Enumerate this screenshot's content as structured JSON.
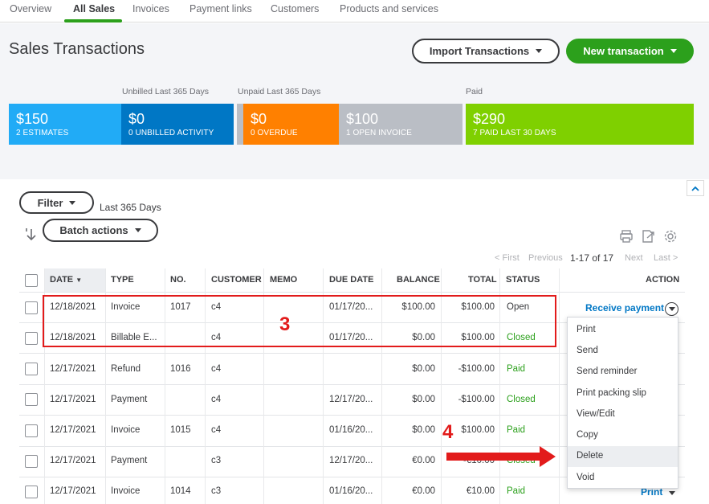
{
  "tabs": [
    {
      "label": "Overview"
    },
    {
      "label": "All Sales",
      "active": true
    },
    {
      "label": "Invoices"
    },
    {
      "label": "Payment links"
    },
    {
      "label": "Customers"
    },
    {
      "label": "Products and services"
    }
  ],
  "header": {
    "title": "Sales Transactions",
    "import_label": "Import Transactions",
    "new_label": "New transaction"
  },
  "money_bar": {
    "unbilled_label": "Unbilled Last 365 Days",
    "unpaid_label": "Unpaid Last 365 Days",
    "paid_label": "Paid",
    "tiles": [
      {
        "amount": "$150",
        "sub": "2 ESTIMATES",
        "color": "#21abf6"
      },
      {
        "amount": "$0",
        "sub": "0 UNBILLED ACTIVITY",
        "color": "#0077c5"
      },
      {
        "amount": "$0",
        "sub": "0 OVERDUE",
        "color": "#ff8000"
      },
      {
        "amount": "$100",
        "sub": "1 OPEN INVOICE",
        "color": "#babec5"
      },
      {
        "amount": "$290",
        "sub": "7 PAID LAST 30 DAYS",
        "color": "#7fd000"
      }
    ]
  },
  "filter": {
    "filter_label": "Filter",
    "range_note": "Last 365 Days",
    "batch_label": "Batch actions"
  },
  "pager": {
    "first": "< First",
    "previous": "Previous",
    "count": "1-17 of 17",
    "next": "Next",
    "last": "Last >"
  },
  "table": {
    "headers": {
      "date": "DATE",
      "type": "TYPE",
      "no": "NO.",
      "customer": "CUSTOMER",
      "memo": "MEMO",
      "due_date": "DUE DATE",
      "balance": "BALANCE",
      "total": "TOTAL",
      "status": "STATUS",
      "action": "ACTION"
    },
    "rows": [
      {
        "date": "12/18/2021",
        "type": "Invoice",
        "no": "1017",
        "customer": "c4",
        "memo": "",
        "due": "01/17/20...",
        "balance": "$100.00",
        "total": "$100.00",
        "status": "Open"
      },
      {
        "date": "12/18/2021",
        "type": "Billable E...",
        "no": "",
        "customer": "c4",
        "memo": "",
        "due": "01/17/20...",
        "balance": "$0.00",
        "total": "$100.00",
        "status": "Closed"
      },
      {
        "date": "12/17/2021",
        "type": "Refund",
        "no": "1016",
        "customer": "c4",
        "memo": "",
        "due": "",
        "balance": "$0.00",
        "total": "-$100.00",
        "status": "Paid"
      },
      {
        "date": "12/17/2021",
        "type": "Payment",
        "no": "",
        "customer": "c4",
        "memo": "",
        "due": "12/17/20...",
        "balance": "$0.00",
        "total": "-$100.00",
        "status": "Closed"
      },
      {
        "date": "12/17/2021",
        "type": "Invoice",
        "no": "1015",
        "customer": "c4",
        "memo": "",
        "due": "01/16/20...",
        "balance": "$0.00",
        "total": "$100.00",
        "status": "Paid"
      },
      {
        "date": "12/17/2021",
        "type": "Payment",
        "no": "",
        "customer": "c3",
        "memo": "",
        "due": "12/17/20...",
        "balance": "€0.00",
        "total": "-€10.00",
        "status": "Closed"
      },
      {
        "date": "12/17/2021",
        "type": "Invoice",
        "no": "1014",
        "customer": "c3",
        "memo": "",
        "due": "01/16/20...",
        "balance": "€0.00",
        "total": "€10.00",
        "status": "Paid"
      }
    ],
    "action_receive": "Receive payment",
    "action_print": "Print"
  },
  "dropdown": {
    "items": [
      "Print",
      "Send",
      "Send reminder",
      "Print packing slip",
      "View/Edit",
      "Copy",
      "Delete",
      "Void"
    ]
  },
  "annotations": {
    "step3": "3",
    "step4": "4"
  }
}
